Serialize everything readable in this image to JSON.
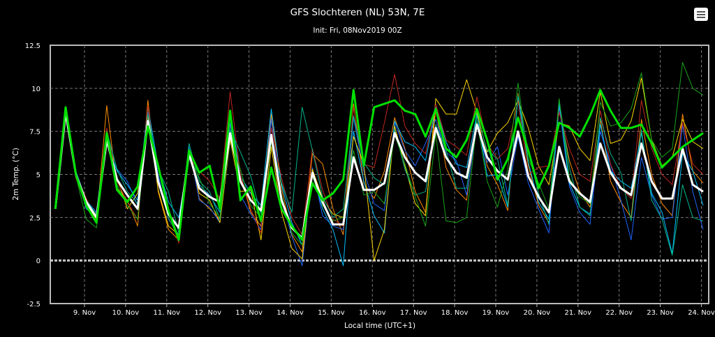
{
  "chart_data": {
    "type": "line",
    "title": "GFS Slochteren (NL) 53N, 7E",
    "subtitle": "Init: Fri, 08Nov2019 00Z",
    "xlabel": "Local time (UTC+1)",
    "ylabel": "2m Temp. (°C)",
    "ylim": [
      -2.5,
      12.5
    ],
    "yticks": [
      "-2.5",
      "0",
      "2.5",
      "5",
      "7.5",
      "10",
      "12.5"
    ],
    "xticks": [
      "9. Nov",
      "10. Nov",
      "11. Nov",
      "12. Nov",
      "13. Nov",
      "14. Nov",
      "15. Nov",
      "16. Nov",
      "17. Nov",
      "18. Nov",
      "19. Nov",
      "20. Nov",
      "21. Nov",
      "22. Nov",
      "23. Nov",
      "24. Nov"
    ],
    "x_start_hours_before_first_tick": 17,
    "step_hours": 6,
    "grid": true,
    "series": [
      {
        "name": "member-orange",
        "color": "#ff8c00",
        "width": 1,
        "values": [
          3.0,
          8.7,
          4.8,
          3.2,
          2.3,
          9.0,
          4.2,
          3.5,
          2.0,
          9.3,
          4.0,
          1.8,
          1.2,
          6.5,
          3.6,
          3.0,
          2.4,
          7.9,
          5.0,
          2.8,
          2.0,
          8.5,
          4.2,
          1.5,
          0.5,
          6.2,
          5.6,
          3.0,
          1.5,
          9.1,
          4.5,
          3.6,
          5.2,
          8.3,
          6.5,
          4.0,
          2.8,
          8.8,
          5.4,
          4.1,
          3.5,
          8.6,
          5.5,
          4.4,
          2.9,
          9.7,
          5.5,
          3.2,
          2.2,
          8.9,
          5.8,
          4.0,
          3.1,
          8.2,
          4.6,
          3.4,
          2.5,
          8.2,
          5.0,
          3.3,
          2.6,
          8.5,
          5.2,
          4.5
        ]
      },
      {
        "name": "member-blue",
        "color": "#1e64ff",
        "width": 1,
        "values": [
          3.0,
          8.5,
          5.2,
          3.5,
          2.8,
          7.5,
          5.3,
          4.6,
          3.2,
          8.6,
          5.0,
          2.4,
          1.5,
          6.6,
          3.5,
          3.1,
          2.2,
          8.0,
          3.8,
          2.7,
          1.8,
          8.2,
          3.6,
          1.4,
          -0.3,
          5.4,
          2.6,
          2.0,
          1.8,
          8.3,
          5.2,
          3.3,
          2.9,
          8.0,
          6.4,
          5.5,
          6.8,
          8.2,
          6.3,
          5.8,
          3.8,
          7.8,
          5.7,
          6.6,
          3.8,
          7.2,
          4.5,
          3.0,
          1.6,
          9.0,
          4.3,
          2.8,
          2.1,
          7.5,
          5.6,
          3.5,
          1.2,
          6.0,
          3.8,
          2.4,
          2.5,
          7.9,
          4.0,
          1.8
        ]
      },
      {
        "name": "member-cyan",
        "color": "#00c0ff",
        "width": 1,
        "values": [
          3.0,
          8.6,
          5.1,
          3.0,
          2.6,
          6.8,
          5.2,
          4.4,
          3.5,
          8.9,
          5.5,
          3.4,
          2.5,
          6.0,
          4.4,
          3.8,
          2.8,
          8.7,
          4.9,
          3.9,
          3.2,
          8.8,
          4.4,
          2.2,
          0.9,
          5.0,
          3.0,
          1.8,
          -0.3,
          7.5,
          4.6,
          2.6,
          1.6,
          8.1,
          6.9,
          6.6,
          5.8,
          8.9,
          6.9,
          5.6,
          5.4,
          8.5,
          4.9,
          5.0,
          3.1,
          9.5,
          5.7,
          3.4,
          2.4,
          9.2,
          4.5,
          3.1,
          2.7,
          7.9,
          5.2,
          4.6,
          4.2,
          7.4,
          3.9,
          2.8,
          0.4,
          6.2,
          5.2,
          3.2
        ]
      },
      {
        "name": "member-yellow",
        "color": "#ffd700",
        "width": 1,
        "values": [
          3.0,
          8.6,
          4.9,
          3.3,
          2.4,
          7.3,
          4.8,
          3.0,
          3.9,
          8.4,
          4.1,
          2.0,
          1.5,
          6.3,
          3.9,
          3.5,
          2.2,
          7.0,
          4.0,
          4.1,
          1.2,
          6.6,
          2.8,
          0.7,
          0.1,
          5.3,
          3.6,
          2.7,
          2.5,
          7.2,
          5.6,
          0.0,
          1.8,
          7.8,
          5.5,
          3.3,
          2.6,
          9.4,
          8.5,
          8.5,
          10.5,
          8.6,
          6.3,
          7.4,
          8.0,
          9.3,
          7.7,
          5.5,
          4.4,
          8.0,
          7.8,
          6.5,
          5.8,
          9.8,
          6.8,
          7.0,
          8.1,
          10.6,
          7.0,
          5.5,
          6.0,
          8.2,
          6.9,
          6.5
        ]
      },
      {
        "name": "member-red",
        "color": "#c0281e",
        "width": 1,
        "values": [
          3.0,
          8.7,
          5.0,
          3.6,
          2.5,
          7.7,
          4.6,
          3.4,
          2.4,
          9.0,
          4.4,
          3.0,
          1.0,
          6.0,
          5.2,
          4.6,
          3.6,
          9.8,
          5.0,
          3.0,
          1.6,
          7.7,
          4.8,
          2.5,
          1.5,
          6.5,
          4.1,
          2.4,
          2.0,
          8.9,
          5.6,
          5.4,
          8.0,
          10.8,
          7.8,
          6.8,
          6.2,
          9.1,
          7.0,
          6.6,
          6.1,
          9.5,
          6.8,
          5.9,
          6.5,
          9.3,
          5.0,
          5.4,
          5.5,
          8.6,
          6.5,
          5.0,
          4.6,
          8.7,
          5.6,
          4.2,
          3.6,
          9.3,
          6.5,
          5.0,
          4.4,
          8.0,
          5.6,
          5.0
        ]
      },
      {
        "name": "member-teal",
        "color": "#00b48c",
        "width": 1,
        "values": [
          3.0,
          8.8,
          5.1,
          3.5,
          2.7,
          7.5,
          5.3,
          4.0,
          3.3,
          8.5,
          5.3,
          4.0,
          1.6,
          6.8,
          4.6,
          4.0,
          2.4,
          7.6,
          6.3,
          4.9,
          2.7,
          7.0,
          4.5,
          2.8,
          8.9,
          6.4,
          3.7,
          2.5,
          3.0,
          8.4,
          5.7,
          4.8,
          4.4,
          7.6,
          5.3,
          3.8,
          4.0,
          7.9,
          6.4,
          4.2,
          4.2,
          8.4,
          6.4,
          5.9,
          3.2,
          9.6,
          6.3,
          3.9,
          2.1,
          9.3,
          5.4,
          3.1,
          2.6,
          8.3,
          6.2,
          5.1,
          2.3,
          7.6,
          3.5,
          2.4,
          0.3,
          4.4,
          2.5,
          2.3
        ]
      },
      {
        "name": "member-darkgreen",
        "color": "#19a519",
        "width": 1,
        "values": [
          3.0,
          8.5,
          4.9,
          2.4,
          1.9,
          7.4,
          4.4,
          3.2,
          2.4,
          8.0,
          4.5,
          2.5,
          1.3,
          6.1,
          4.8,
          3.3,
          2.5,
          7.1,
          5.3,
          3.2,
          2.5,
          6.9,
          3.8,
          1.6,
          0.9,
          4.9,
          3.2,
          2.3,
          2.5,
          6.4,
          3.8,
          4.0,
          3.3,
          7.3,
          5.6,
          3.7,
          2.0,
          7.4,
          2.3,
          2.2,
          2.5,
          8.1,
          4.6,
          3.1,
          5.3,
          10.3,
          5.9,
          4.5,
          3.0,
          9.4,
          4.8,
          3.7,
          3.3,
          9.2,
          7.8,
          8.0,
          8.8,
          10.9,
          7.0,
          6.0,
          6.5,
          11.5,
          10.0,
          9.6
        ]
      },
      {
        "name": "ensemble-mean",
        "color": "#ffffff",
        "width": 3,
        "values": [
          3.0,
          8.6,
          5.0,
          3.4,
          2.5,
          7.0,
          4.7,
          3.8,
          3.0,
          8.1,
          4.6,
          2.7,
          1.9,
          6.2,
          4.2,
          3.7,
          3.4,
          7.4,
          4.6,
          3.5,
          2.9,
          7.3,
          3.5,
          1.9,
          1.3,
          5.1,
          3.4,
          2.1,
          2.1,
          6.0,
          4.1,
          4.1,
          4.5,
          7.4,
          6.0,
          5.1,
          4.6,
          7.7,
          6.0,
          5.1,
          4.8,
          7.9,
          6.0,
          5.2,
          4.7,
          7.5,
          4.9,
          3.7,
          2.8,
          6.6,
          4.6,
          3.9,
          3.4,
          6.8,
          5.1,
          4.2,
          3.8,
          6.8,
          4.6,
          3.6,
          3.6,
          6.5,
          4.4,
          4.0
        ]
      },
      {
        "name": "control-run",
        "color": "#00e000",
        "width": 3,
        "values": [
          3.0,
          8.9,
          5.0,
          3.2,
          2.2,
          7.4,
          4.1,
          3.4,
          4.3,
          7.8,
          5.5,
          2.9,
          1.2,
          6.4,
          5.1,
          5.5,
          3.0,
          8.7,
          3.5,
          4.3,
          2.3,
          5.4,
          3.0,
          2.0,
          1.2,
          4.5,
          3.5,
          3.9,
          4.7,
          9.9,
          5.5,
          8.9,
          9.1,
          9.3,
          8.7,
          8.5,
          7.2,
          8.8,
          6.5,
          6.0,
          7.0,
          8.8,
          7.0,
          4.7,
          5.9,
          8.3,
          6.4,
          4.2,
          5.5,
          8.0,
          7.7,
          7.2,
          8.4,
          9.9,
          8.7,
          7.7,
          7.7,
          7.9,
          6.8,
          5.4,
          6.0,
          6.6,
          7.0,
          7.4
        ]
      }
    ]
  },
  "menu": {
    "icon": "hamburger-menu-icon"
  }
}
